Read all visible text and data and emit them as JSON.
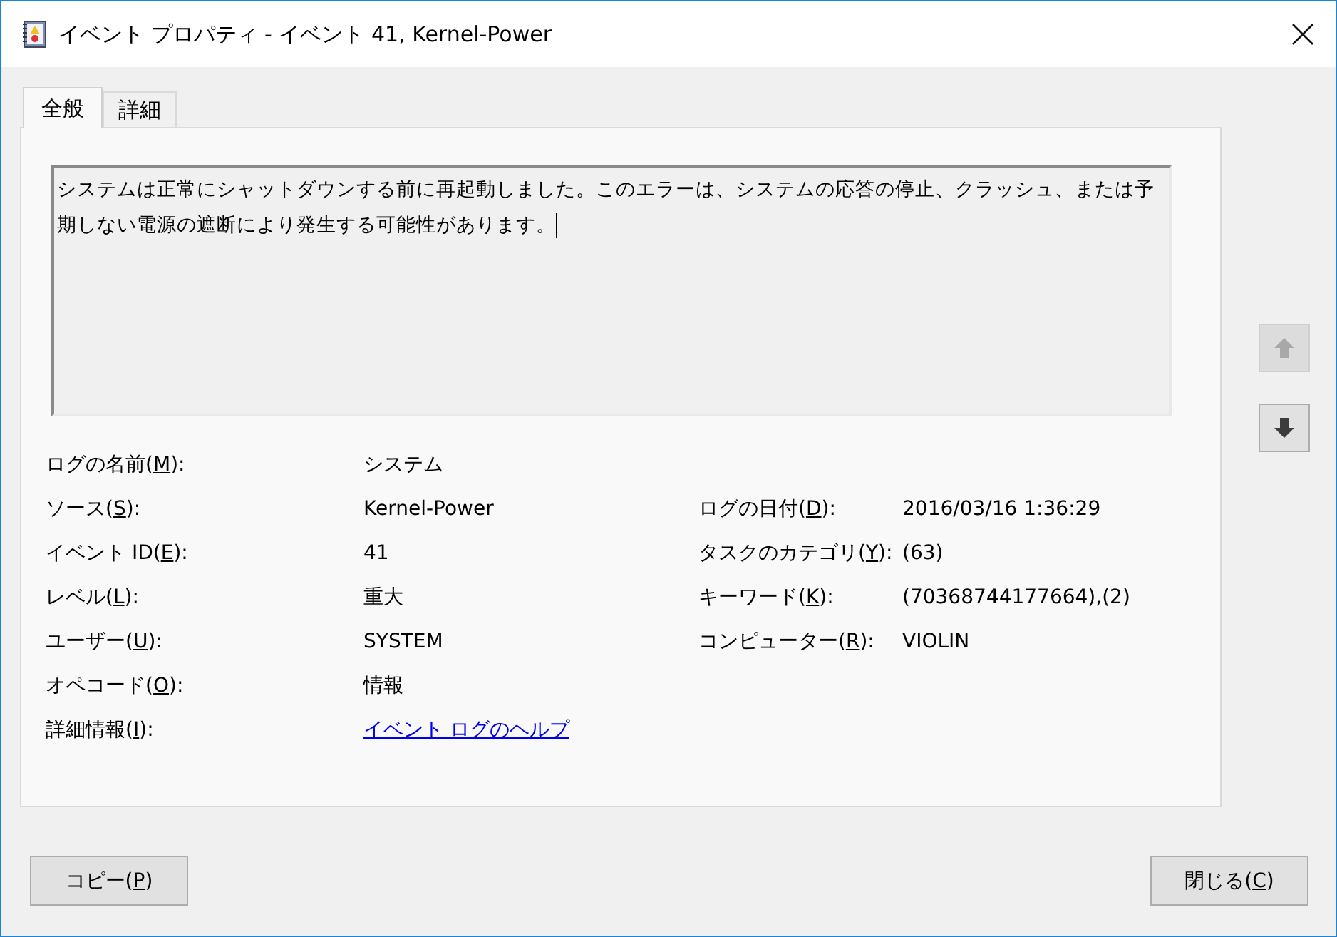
{
  "window": {
    "title": "イベント プロパティ - イベント 41, Kernel-Power"
  },
  "tabs": [
    {
      "label": "全般",
      "selected": true
    },
    {
      "label": "詳細",
      "selected": false
    }
  ],
  "description": "システムは正常にシャットダウンする前に再起動しました。このエラーは、システムの応答の停止、クラッシュ、または予期しない電源の遮断により発生する可能性があります。",
  "nav_buttons": [
    {
      "kind": "up",
      "disabled": true
    },
    {
      "kind": "down",
      "disabled": false
    }
  ],
  "rows": [
    {
      "left": {
        "label": "ログの名前(M):",
        "value": "システム"
      }
    },
    {
      "left": {
        "label": "ソース(S):",
        "value": "Kernel-Power"
      },
      "right": {
        "label": "ログの日付(D):",
        "value": "2016/03/16 1:36:29"
      }
    },
    {
      "left": {
        "label": "イベント ID(E):",
        "value": "41"
      },
      "right": {
        "label": "タスクのカテゴリ(Y):",
        "value": "(63)"
      }
    },
    {
      "left": {
        "label": "レベル(L):",
        "value": "重大"
      },
      "right": {
        "label": "キーワード(K):",
        "value": "(70368744177664),(2)"
      }
    },
    {
      "left": {
        "label": "ユーザー(U):",
        "value": "SYSTEM"
      },
      "right": {
        "label": "コンピューター(R):",
        "value": "VIOLIN"
      }
    },
    {
      "left": {
        "label": "オペコード(O):",
        "value": "情報"
      }
    },
    {
      "left": {
        "label": "詳細情報(I):",
        "value": "イベント ログのヘルプ",
        "kind": "link"
      }
    }
  ],
  "buttons": [
    "コピー(P)",
    "閉じる(C)"
  ]
}
